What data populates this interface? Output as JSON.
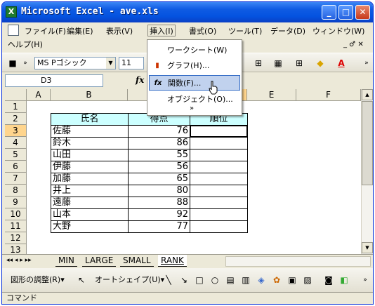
{
  "window": {
    "title": "Microsoft Excel - ave.xls",
    "minimize": "_",
    "maximize": "□",
    "close": "✕"
  },
  "menubar": {
    "items": [
      "ファイル(F)",
      "編集(E)",
      "表示(V)",
      "挿入(I)",
      "書式(O)",
      "ツール(T)",
      "データ(D)",
      "ウィンドウ(W)"
    ],
    "help": "ヘルプ(H)",
    "right_controls": "_ ♂ ✕"
  },
  "toolbar": {
    "font_name": "MS Pゴシック",
    "font_size": "11"
  },
  "formula": {
    "cell_ref": "D3",
    "fx": "fx",
    "value": ""
  },
  "columns": [
    "A",
    "B",
    "C",
    "D",
    "E",
    "F"
  ],
  "rows": [
    "1",
    "2",
    "3",
    "4",
    "5",
    "6",
    "7",
    "8",
    "9",
    "10",
    "11",
    "12",
    "13"
  ],
  "sheet": {
    "header": {
      "name": "氏名",
      "score": "得点",
      "rank": "順位"
    },
    "records": [
      {
        "name": "佐藤",
        "score": "76"
      },
      {
        "name": "鈴木",
        "score": "86"
      },
      {
        "name": "山田",
        "score": "55"
      },
      {
        "name": "伊藤",
        "score": "56"
      },
      {
        "name": "加藤",
        "score": "65"
      },
      {
        "name": "井上",
        "score": "80"
      },
      {
        "name": "遠藤",
        "score": "88"
      },
      {
        "name": "山本",
        "score": "92"
      },
      {
        "name": "大野",
        "score": "77"
      }
    ]
  },
  "insert_menu": {
    "items": [
      "ワークシート(W)",
      "グラフ(H)...",
      "関数(F)...",
      "オブジェクト(O)..."
    ],
    "expand": "»",
    "highlighted": "関数(F)..."
  },
  "tabs": {
    "nav": "◂◂ ◂ ▸ ▸▸",
    "sheets": [
      "MIN",
      "LARGE",
      "SMALL",
      "RANK"
    ],
    "active": "RANK"
  },
  "drawbar": {
    "draw_label": "図形の調整(R)▾",
    "autoshape_label": "オートシェイプ(U)▾"
  },
  "statusbar": {
    "text": "コマンド"
  }
}
